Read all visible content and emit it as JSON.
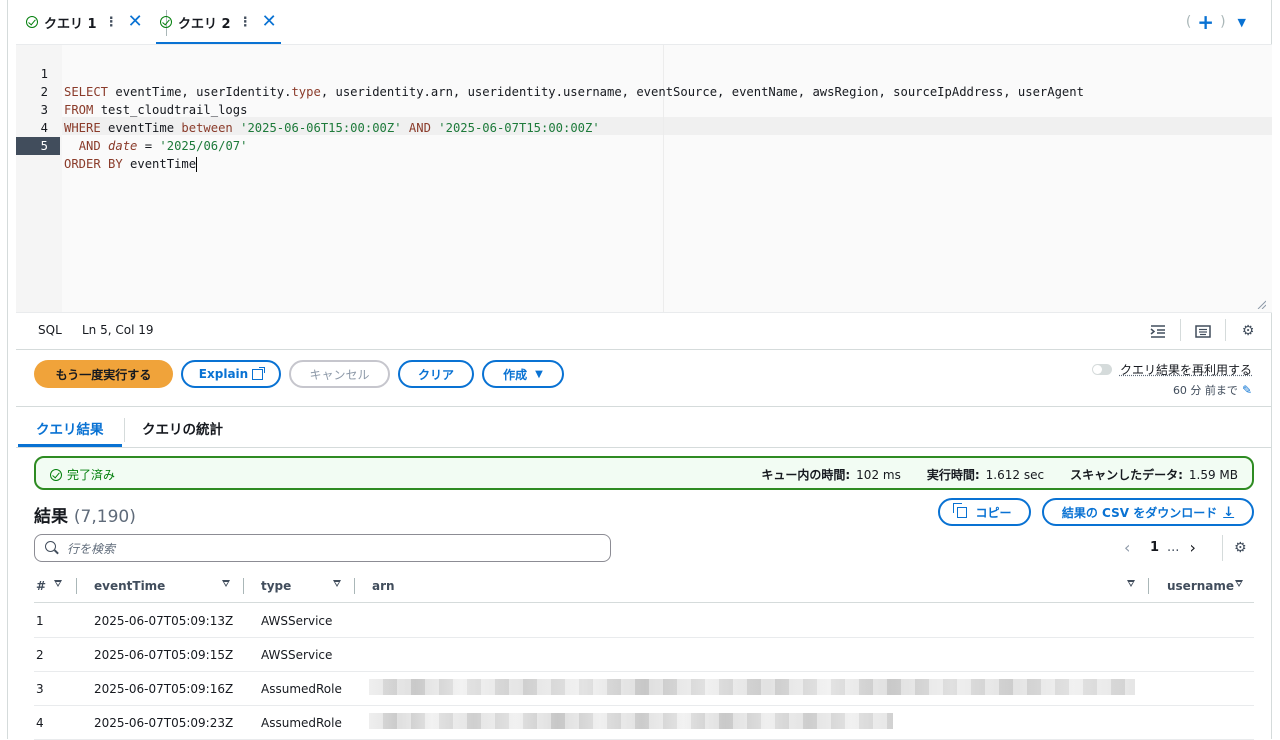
{
  "tabs": [
    {
      "label": "クエリ 1",
      "status": "completed"
    },
    {
      "label": "クエリ 2",
      "status": "completed",
      "active": true
    }
  ],
  "tab_actions": {
    "plus": "+",
    "paren_open": "(",
    "paren_close": ")"
  },
  "editor": {
    "language": "SQL",
    "cursor_position": "Ln 5, Col 19",
    "line_numbers": [
      "1",
      "2",
      "3",
      "4",
      "5"
    ],
    "line1": {
      "kw1": "SELECT",
      "rest1": " eventTime, userIdentity.",
      "kw2": "type",
      "rest2": ", useridentity.arn, useridentity.username, eventSource, eventName, awsRegion, sourceIpAddress, userAgent"
    },
    "line2": {
      "kw1": "FROM",
      "rest1": " test_cloudtrail_logs"
    },
    "line3": {
      "kw1": "WHERE",
      "rest1": " eventTime ",
      "kw2": "between",
      "rest2": " ",
      "str1": "'2025-06-06T15:00:00Z'",
      "rest3": " ",
      "kw3": "AND",
      "rest4": " ",
      "str2": "'2025-06-07T15:00:00Z'"
    },
    "line4": {
      "indent": "  ",
      "kw1": "AND",
      "rest1": " ",
      "it1": "date",
      "rest2": " = ",
      "str1": "'2025/06/07'"
    },
    "line5": {
      "kw1": "ORDER BY",
      "rest1": " eventTime"
    }
  },
  "actions": {
    "run_again": "もう一度実行する",
    "explain": "Explain",
    "cancel": "キャンセル",
    "clear": "クリア",
    "create": "作成",
    "reuse_label": "クエリ結果を再利用する",
    "reuse_sub": "60 分 前まで"
  },
  "result_tabs": {
    "results": "クエリ結果",
    "stats": "クエリの統計"
  },
  "banner": {
    "status": "完了済み",
    "queue_label": "キュー内の時間:",
    "queue_value": "102 ms",
    "exec_label": "実行時間:",
    "exec_value": "1.612 sec",
    "scan_label": "スキャンしたデータ:",
    "scan_value": "1.59 MB"
  },
  "results": {
    "title": "結果",
    "count": "(7,190)",
    "copy": "コピー",
    "download_csv": "結果の CSV をダウンロード",
    "search_placeholder": "行を検索",
    "page": "1",
    "ellipsis": "...",
    "columns": [
      "#",
      "eventTime",
      "type",
      "arn",
      "username"
    ],
    "rows": [
      {
        "n": "1",
        "eventTime": "2025-06-07T05:09:13Z",
        "type": "AWSService",
        "arn_redacted": false
      },
      {
        "n": "2",
        "eventTime": "2025-06-07T05:09:15Z",
        "type": "AWSService",
        "arn_redacted": false
      },
      {
        "n": "3",
        "eventTime": "2025-06-07T05:09:16Z",
        "type": "AssumedRole",
        "arn_redacted": true
      },
      {
        "n": "4",
        "eventTime": "2025-06-07T05:09:23Z",
        "type": "AssumedRole",
        "arn_redacted": true
      }
    ]
  },
  "colors": {
    "accent": "#0972d3",
    "primary_button": "#f0a33a",
    "success": "#037f0c"
  }
}
